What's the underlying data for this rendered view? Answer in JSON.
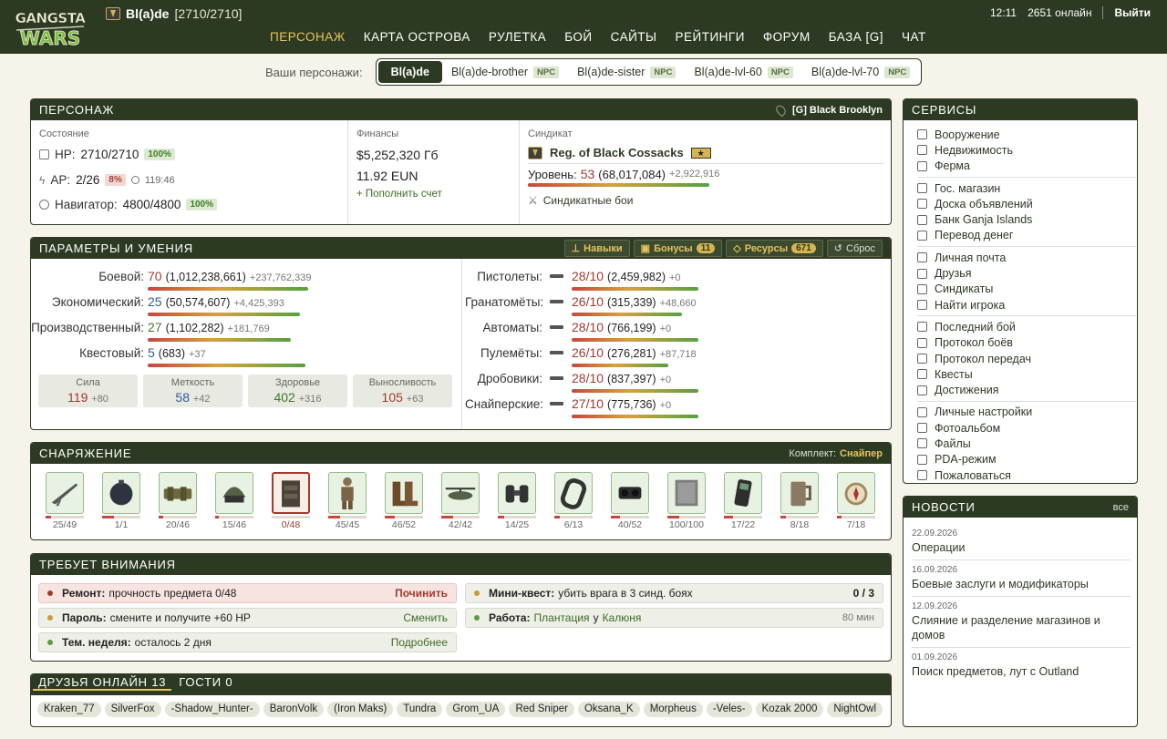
{
  "header": {
    "logo_text": "GANGSTA WARS",
    "char_name": "Bl(a)de",
    "char_hp": "[2710/2710]",
    "time": "12:11",
    "online": "2651 онлайн",
    "logout": "Выйти",
    "nav": [
      "ПЕРСОНАЖ",
      "КАРТА ОСТРОВА",
      "РУЛЕТКА",
      "БОЙ",
      "САЙТЫ",
      "РЕЙТИНГИ",
      "ФОРУМ",
      "БАЗА [G]",
      "ЧАТ"
    ]
  },
  "chars": {
    "label": "Ваши персонажи:",
    "active": "Bl(a)de",
    "others": [
      "Bl(a)de-brother",
      "Bl(a)de-sister",
      "Bl(a)de-lvl-60",
      "Bl(a)de-lvl-70"
    ],
    "npc": "NPC"
  },
  "person": {
    "title": "ПЕРСОНАЖ",
    "location": "[G] Black Brooklyn",
    "state_label": "Состояние",
    "hp_k": "HP:",
    "hp_v": "2710/2710",
    "hp_b": "100%",
    "ap_k": "AP:",
    "ap_v": "2/26",
    "ap_b": "8%",
    "ap_t": "119:46",
    "nav_k": "Навигатор:",
    "nav_v": "4800/4800",
    "nav_b": "100%",
    "fin_label": "Финансы",
    "money": "$5,252,320 Гб",
    "eun": "11.92 EUN",
    "topup": "+ Пополнить счет",
    "synd_label": "Синдикат",
    "synd_name": "Reg. of Black Cossacks",
    "lvl_k": "Уровень:",
    "lvl_v": "53",
    "lvl_exp": "(68,017,084)",
    "lvl_plus": "+2,922,916",
    "lvl_fill": 0.96,
    "synd_fights": "Синдикатные бои"
  },
  "skills": {
    "title": "ПАРАМЕТРЫ И УМЕНИЯ",
    "btn_skills": "Навыки",
    "btn_bonus": "Бонусы",
    "bonus_n": "11",
    "btn_res": "Ресурсы",
    "res_n": "671",
    "btn_reset": "Сброс",
    "left": [
      {
        "k": "Боевой:",
        "v": "70",
        "e": "(1,012,238,661)",
        "p": "+237,762,339",
        "fill": 0.98
      },
      {
        "k": "Экономический:",
        "v": "25",
        "e": "(50,574,607)",
        "p": "+4,425,393",
        "fill": 0.93
      },
      {
        "k": "Производственный:",
        "v": "27",
        "e": "(1,102,282)",
        "p": "+181,769",
        "fill": 0.87
      },
      {
        "k": "Квестовый:",
        "v": "5",
        "e": "(683)",
        "p": "+37",
        "fill": 0.96
      }
    ],
    "tiles": [
      {
        "t": "Сила",
        "v": "119",
        "p": "+80"
      },
      {
        "t": "Меткость",
        "v": "58",
        "p": "+42"
      },
      {
        "t": "Здоровье",
        "v": "402",
        "p": "+316"
      },
      {
        "t": "Выносливость",
        "v": "105",
        "p": "+63"
      }
    ],
    "right": [
      {
        "k": "Пистолеты:",
        "v": "28/10",
        "e": "(2,459,982)",
        "p": "+0",
        "fill": 1
      },
      {
        "k": "Гранатомёты:",
        "v": "26/10",
        "e": "(315,339)",
        "p": "+48,660",
        "fill": 0.87
      },
      {
        "k": "Автоматы:",
        "v": "28/10",
        "e": "(766,199)",
        "p": "+0",
        "fill": 1
      },
      {
        "k": "Пулемёты:",
        "v": "26/10",
        "e": "(276,281)",
        "p": "+87,718",
        "fill": 0.76
      },
      {
        "k": "Дробовики:",
        "v": "28/10",
        "e": "(837,397)",
        "p": "+0",
        "fill": 1
      },
      {
        "k": "Снайперские:",
        "v": "27/10",
        "e": "(775,736)",
        "p": "+0",
        "fill": 1
      }
    ]
  },
  "equip": {
    "title": "СНАРЯЖЕНИЕ",
    "set_label": "Комплект:",
    "set_name": "Снайпер",
    "items": [
      {
        "icon": "sniper-rifle",
        "c": "25/49",
        "f": 0.51
      },
      {
        "icon": "mine",
        "c": "1/1",
        "f": 1
      },
      {
        "icon": "belt",
        "c": "20/46",
        "f": 0.43
      },
      {
        "icon": "helmet",
        "c": "15/46",
        "f": 0.33
      },
      {
        "icon": "vest",
        "c": "0/48",
        "f": 0,
        "bad": true
      },
      {
        "icon": "suit",
        "c": "45/45",
        "f": 1
      },
      {
        "icon": "boots",
        "c": "46/52",
        "f": 0.88
      },
      {
        "icon": "helicopter",
        "c": "42/42",
        "f": 1
      },
      {
        "icon": "binoculars",
        "c": "14/25",
        "f": 0.56
      },
      {
        "icon": "bracelet",
        "c": "6/13",
        "f": 0.46
      },
      {
        "icon": "nightvision",
        "c": "40/52",
        "f": 0.77
      },
      {
        "icon": "armor-plate",
        "c": "100/100",
        "f": 1
      },
      {
        "icon": "phone",
        "c": "17/22",
        "f": 0.77
      },
      {
        "icon": "mug",
        "c": "8/18",
        "f": 0.44
      },
      {
        "icon": "compass",
        "c": "7/18",
        "f": 0.39
      }
    ]
  },
  "attention": {
    "title": "ТРЕБУЕТ ВНИМАНИЯ",
    "items": [
      {
        "b": "Ремонт:",
        "t": "прочность предмета 0/48",
        "a": "Починить",
        "dot": "#a33a2e"
      },
      {
        "b": "Пароль:",
        "t": "смените и получите +60 HP",
        "a": "Сменить",
        "dot": "#c79a3a"
      },
      {
        "b": "Тем. неделя:",
        "t": "осталось 2 дня",
        "a": "Подробнее",
        "dot": "#5c9a45"
      },
      {
        "b": "Мини-квест:",
        "t": "убить врага в 3 синд. боях",
        "a": "0 / 3",
        "dot": "#c79a3a"
      },
      {
        "b": "Работа:",
        "t": "Плантация",
        "t2": "у",
        "t3": "Калюня",
        "a": "80 мин",
        "dot": "#5c9a45"
      }
    ]
  },
  "friends": {
    "tab1": "ДРУЗЬЯ ОНЛАЙН 13",
    "tab2": "ГОСТИ 0",
    "list": [
      "Kraken_77",
      "SilverFox",
      "-Shadow_Hunter-",
      "BaronVolk",
      "(Iron Maks)",
      "Tundra",
      "Grom_UA",
      "Red Sniper",
      "Oksana_K",
      "Morpheus",
      "-Veles-",
      "Kozak 2000",
      "NightOwl"
    ]
  },
  "services": {
    "title": "СЕРВИСЫ",
    "groups": [
      [
        "Вооружение",
        "Недвижимость",
        "Ферма"
      ],
      [
        "Гос. магазин",
        "Доска объявлений",
        "Банк Ganja Islands",
        "Перевод денег"
      ],
      [
        "Личная почта",
        "Друзья",
        "Синдикаты",
        "Найти игрока"
      ],
      [
        "Последний бой",
        "Протокол боёв",
        "Протокол передач",
        "Квесты",
        "Достижения"
      ],
      [
        "Личные настройки",
        "Фотоальбом",
        "Файлы",
        "PDA-режим",
        "Пожаловаться"
      ]
    ]
  },
  "news": {
    "title": "НОВОСТИ",
    "all": "все",
    "items": [
      {
        "d": "22.09.2026",
        "t": "Операции"
      },
      {
        "d": "16.09.2026",
        "t": "Боевые заслуги и модификаторы"
      },
      {
        "d": "12.09.2026",
        "t": "Слияние и разделение магазинов и домов"
      },
      {
        "d": "01.09.2026",
        "t": "Поиск предметов, лут с Outland"
      }
    ]
  }
}
